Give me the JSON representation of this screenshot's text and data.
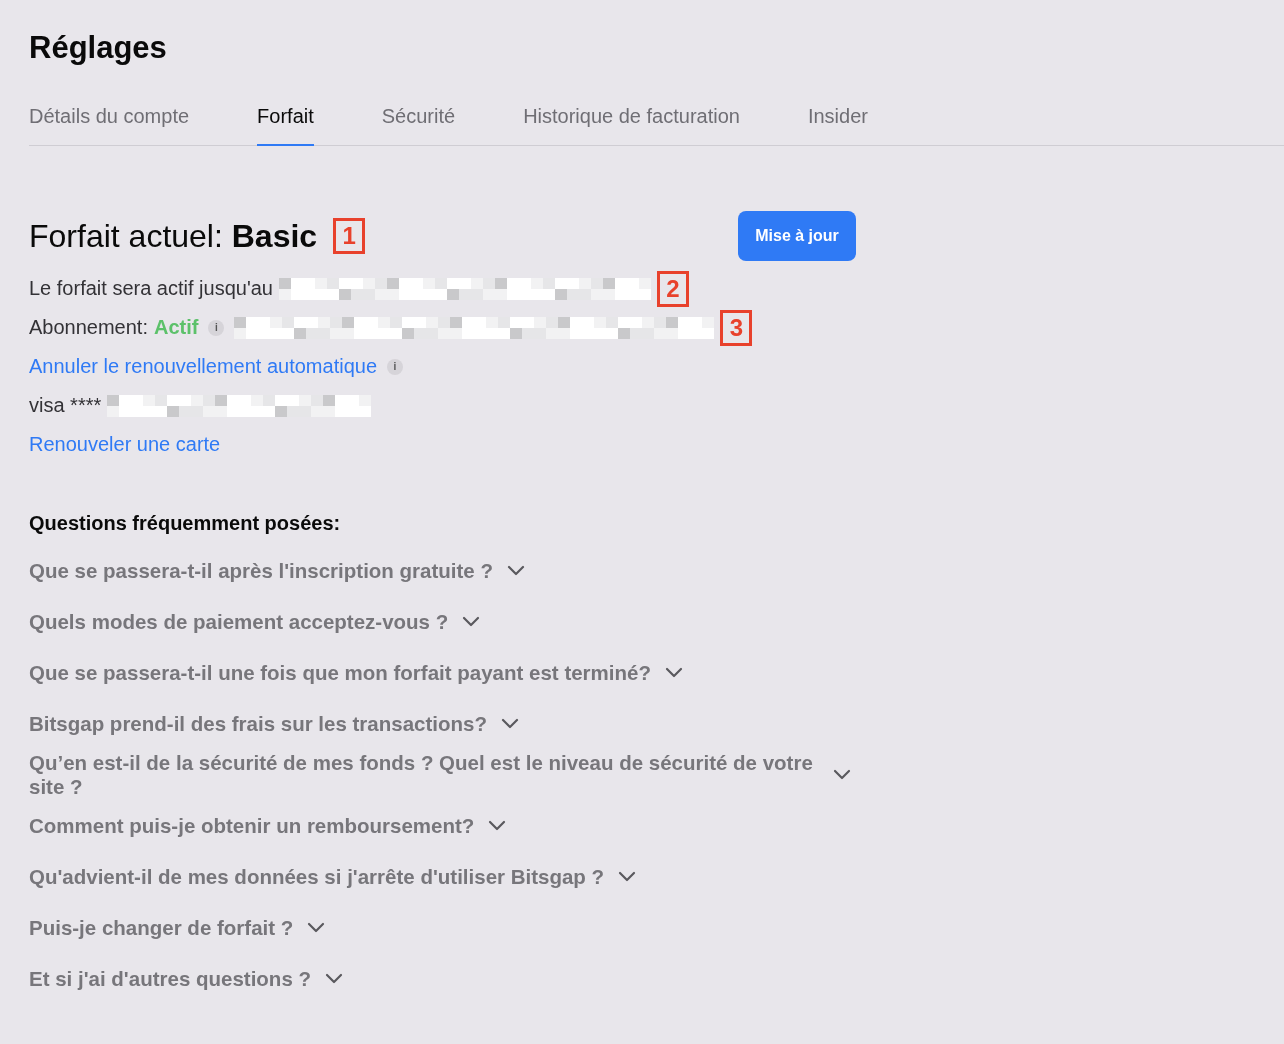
{
  "page": {
    "title": "Réglages"
  },
  "tabs": [
    {
      "label": "Détails du compte",
      "selected": false
    },
    {
      "label": "Forfait",
      "selected": true
    },
    {
      "label": "Sécurité",
      "selected": false
    },
    {
      "label": "Historique de facturation",
      "selected": false
    },
    {
      "label": "Insider",
      "selected": false
    }
  ],
  "plan": {
    "label": "Forfait actuel:",
    "name": "Basic",
    "callout": "1",
    "upgrade_button": "Mise à jour"
  },
  "details": [
    {
      "kind": "text",
      "text": "Le forfait sera actif jusqu'au",
      "redacted": true,
      "callout": "2"
    },
    {
      "kind": "status",
      "text": "Abonnement:",
      "status": "Actif",
      "info": "i",
      "redacted": true,
      "callout": "3"
    },
    {
      "kind": "link",
      "text": "Annuler le renouvellement automatique",
      "info": "i"
    },
    {
      "kind": "text",
      "text": "visa ****",
      "redacted": true
    },
    {
      "kind": "link",
      "text": "Renouveler une carte"
    }
  ],
  "faq": {
    "title": "Questions fréquemment posées:",
    "items": [
      {
        "question": "Que se passera-t-il après l'inscription gratuite ?",
        "expanded": false
      },
      {
        "question": "Quels modes de paiement acceptez-vous ?",
        "expanded": false
      },
      {
        "question": "Que se passera-t-il une fois que mon forfait payant est terminé?",
        "expanded": false
      },
      {
        "question": "Bitsgap prend-il des frais sur les transactions?",
        "expanded": false
      },
      {
        "question": "Qu’en est-il de la sécurité de mes fonds ? Quel est le niveau de sécurité de votre site ?",
        "expanded": false
      },
      {
        "question": "Comment puis-je obtenir un remboursement?",
        "expanded": false
      },
      {
        "question": "Qu'advient-il de mes données si j'arrête d'utiliser Bitsgap ?",
        "expanded": false
      },
      {
        "question": "Puis-je changer de forfait ?",
        "expanded": false
      },
      {
        "question": "Et si j'ai d'autres questions ?",
        "expanded": false
      }
    ]
  }
}
